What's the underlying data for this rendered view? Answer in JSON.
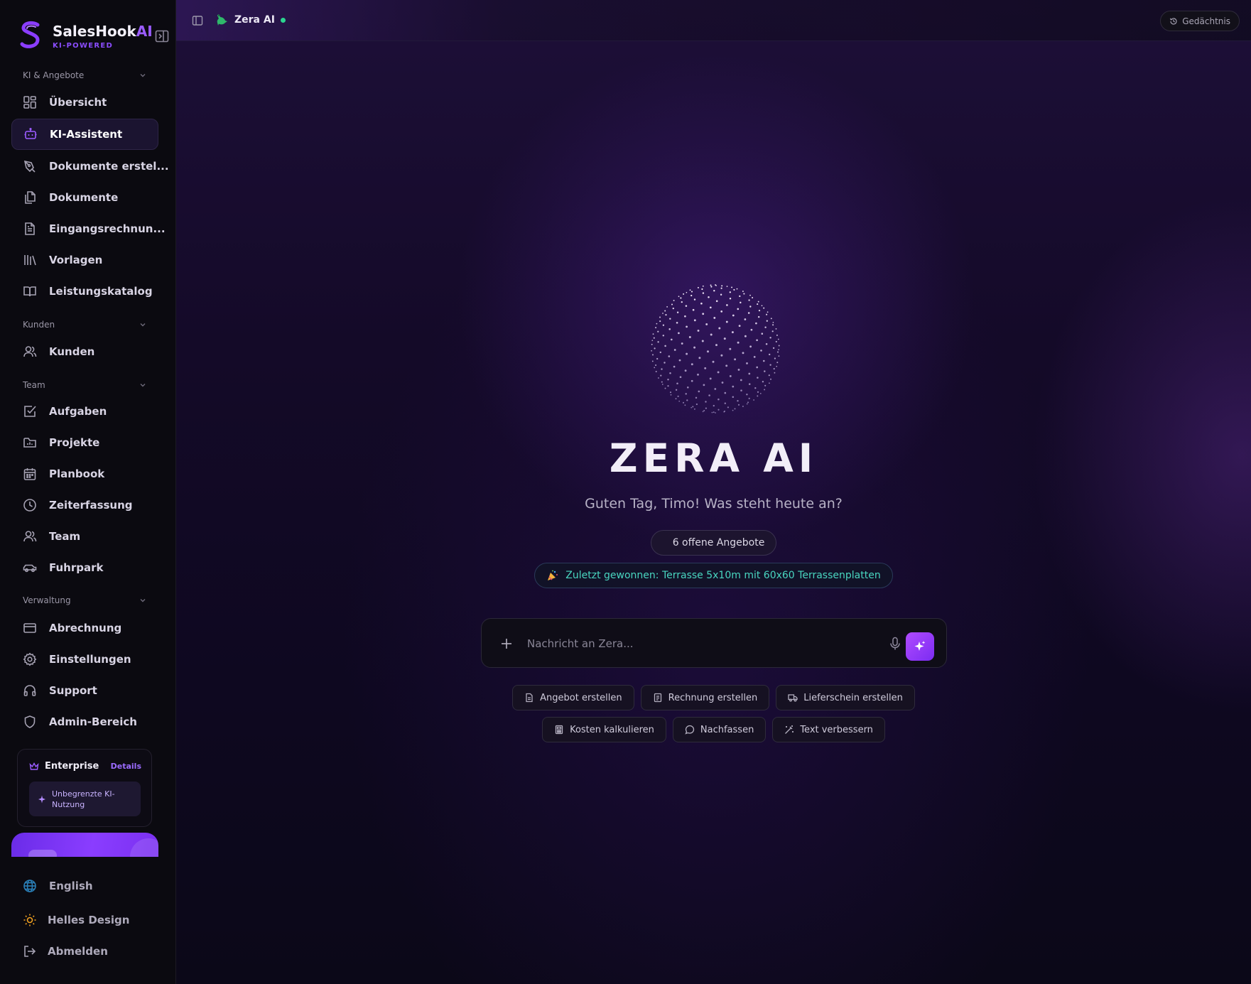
{
  "brand": {
    "name": "SalesHook",
    "name_ai": "AI",
    "tagline": "KI-POWERED"
  },
  "sidebar": {
    "sections": [
      {
        "label": "KI & Angebote"
      },
      {
        "label": "Kunden"
      },
      {
        "label": "Team"
      },
      {
        "label": "Verwaltung"
      }
    ],
    "items": [
      {
        "label": "Übersicht",
        "icon": "grid-icon"
      },
      {
        "label": "KI-Assistent",
        "icon": "bot-icon",
        "active": true
      },
      {
        "label": "Dokumente erstel...",
        "icon": "pen-tool-icon"
      },
      {
        "label": "Dokumente",
        "icon": "files-icon"
      },
      {
        "label": "Eingangsrechnun...",
        "icon": "file-text-icon"
      },
      {
        "label": "Vorlagen",
        "icon": "library-icon"
      },
      {
        "label": "Leistungskatalog",
        "icon": "book-open-icon"
      },
      {
        "label": "Kunden",
        "icon": "users-icon"
      },
      {
        "label": "Aufgaben",
        "icon": "checkbox-icon"
      },
      {
        "label": "Projekte",
        "icon": "folder-chart-icon"
      },
      {
        "label": "Planbook",
        "icon": "calendar-icon"
      },
      {
        "label": "Zeiterfassung",
        "icon": "clock-icon"
      },
      {
        "label": "Team",
        "icon": "users-icon"
      },
      {
        "label": "Fuhrpark",
        "icon": "car-icon"
      },
      {
        "label": "Abrechnung",
        "icon": "credit-card-icon"
      },
      {
        "label": "Einstellungen",
        "icon": "gear-icon"
      },
      {
        "label": "Support",
        "icon": "headphones-icon"
      },
      {
        "label": "Admin-Bereich",
        "icon": "shield-icon"
      }
    ],
    "plan": {
      "title": "Enterprise",
      "details_label": "Details",
      "feature": "Unbegrenzte KI-Nutzung"
    },
    "bottom": [
      {
        "label": "English",
        "icon": "globe-icon"
      },
      {
        "label": "Helles Design",
        "icon": "sun-icon"
      },
      {
        "label": "Abmelden",
        "icon": "logout-icon"
      }
    ]
  },
  "topbar": {
    "title": "Zera AI",
    "memory_label": "Gedächtnis"
  },
  "hero": {
    "title": "ZERA AI",
    "greeting": "Guten Tag, Timo! Was steht heute an?",
    "offers_chip": "6 offene Angebote",
    "won_chip": "Zuletzt gewonnen: Terrasse 5x10m mit 60x60 Terrassenplatten"
  },
  "composer": {
    "placeholder": "Nachricht an Zera..."
  },
  "quick_actions": [
    {
      "label": "Angebot erstellen",
      "icon": "file-icon"
    },
    {
      "label": "Rechnung erstellen",
      "icon": "receipt-icon"
    },
    {
      "label": "Lieferschein erstellen",
      "icon": "truck-icon"
    },
    {
      "label": "Kosten kalkulieren",
      "icon": "calculator-icon"
    },
    {
      "label": "Nachfassen",
      "icon": "message-circle-icon"
    },
    {
      "label": "Text verbessern",
      "icon": "wand-icon"
    }
  ],
  "colors": {
    "accent": "#9b5cff",
    "online": "#2bd48f",
    "won_text": "#49d6c0",
    "send_button": "#9b3cff"
  }
}
